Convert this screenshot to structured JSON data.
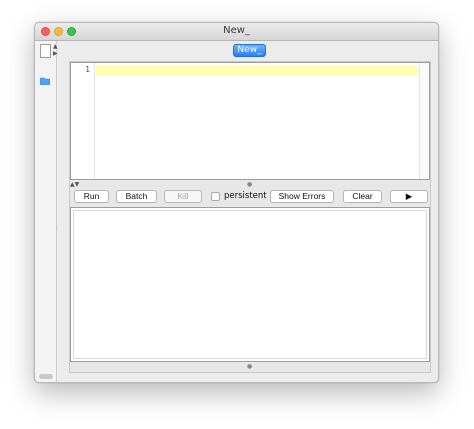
{
  "window": {
    "title": "New_"
  },
  "tab": {
    "label": "New_"
  },
  "editor": {
    "line_numbers": [
      "1"
    ]
  },
  "toolbar": {
    "run_label": "Run",
    "batch_label": "Batch",
    "kill_label": "Kill",
    "persistent_label": "persistent",
    "persistent_checked": false,
    "show_errors_label": "Show Errors",
    "clear_label": "Clear",
    "play_label": "▶"
  },
  "icons": {
    "sidebar_up": "▲",
    "sidebar_right": "▶",
    "split_arrows": "▲▼",
    "grip_dot": "●",
    "sidebar_grip": "⋮"
  },
  "colors": {
    "tab_blue": "#2b80f5",
    "current_line": "#ffffb0",
    "close": "#fc605c",
    "minimize": "#fdbc40",
    "zoom": "#34c84a"
  }
}
